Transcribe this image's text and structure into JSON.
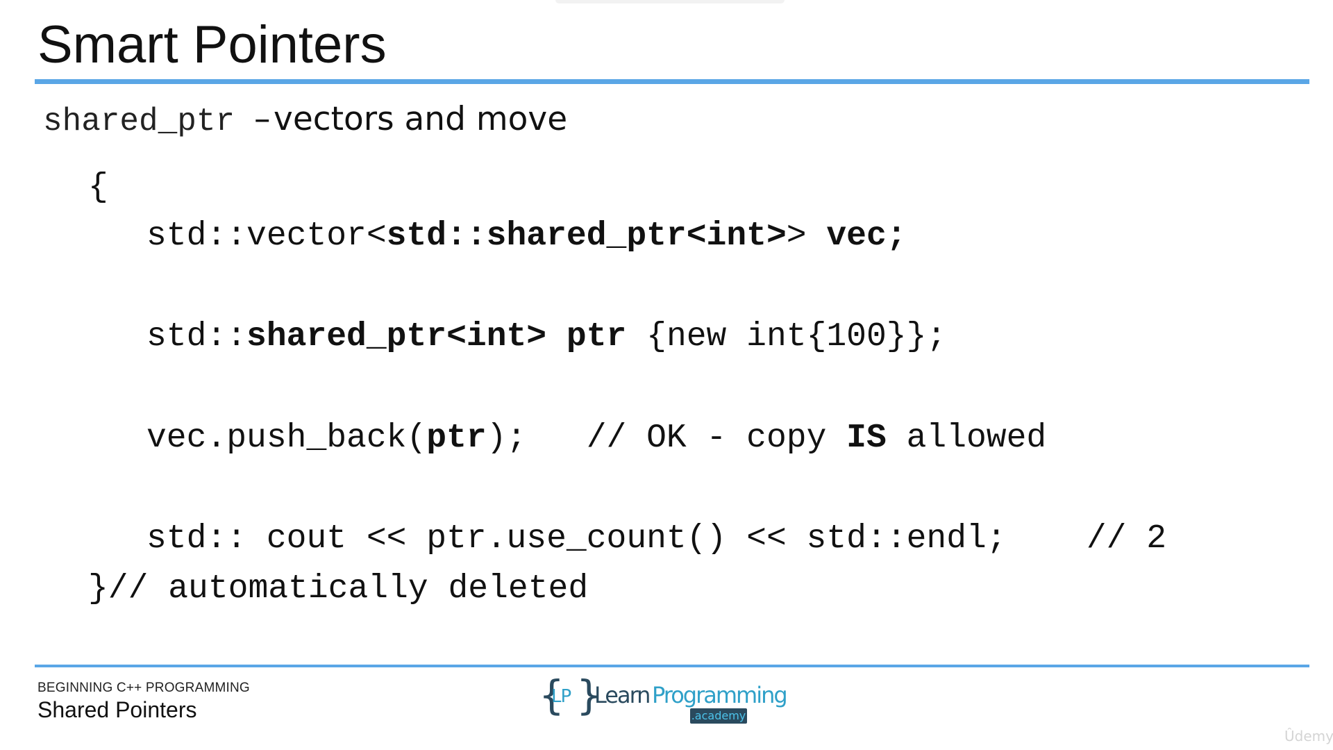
{
  "slide": {
    "title": "Smart Pointers",
    "subtitle": {
      "code": "shared_ptr",
      "dash": "–",
      "text": "vectors and move"
    }
  },
  "code": {
    "open_brace": "{",
    "line1": {
      "a": "std::vector<",
      "b": "std::shared_ptr<int>",
      "c": "> ",
      "d": "vec;"
    },
    "line2": {
      "a": "std::",
      "b": "shared_ptr<int> ptr",
      "c": " {new int{100}};"
    },
    "line3": {
      "a": "vec.push_back(",
      "b": "ptr",
      "c": ");   // OK - copy ",
      "d": "IS",
      "e": " allowed"
    },
    "line4": {
      "a": "std:: cout << ptr.use_count() << std::endl;    // 2"
    },
    "close_line": "}// automatically deleted"
  },
  "footer": {
    "course": "BEGINNING C++ PROGRAMMING",
    "lesson": "Shared Pointers",
    "logo": {
      "brace_left": "{",
      "monogram": "LP",
      "brace_right": "}",
      "word_learn": "Learn",
      "word_programming": "Programming",
      "badge": ".academy"
    }
  },
  "watermark": "Ûdemy",
  "colors": {
    "accent_rule": "#5aa6e6",
    "logo_dark": "#2a4a5e",
    "logo_blue": "#2fa0c8"
  }
}
